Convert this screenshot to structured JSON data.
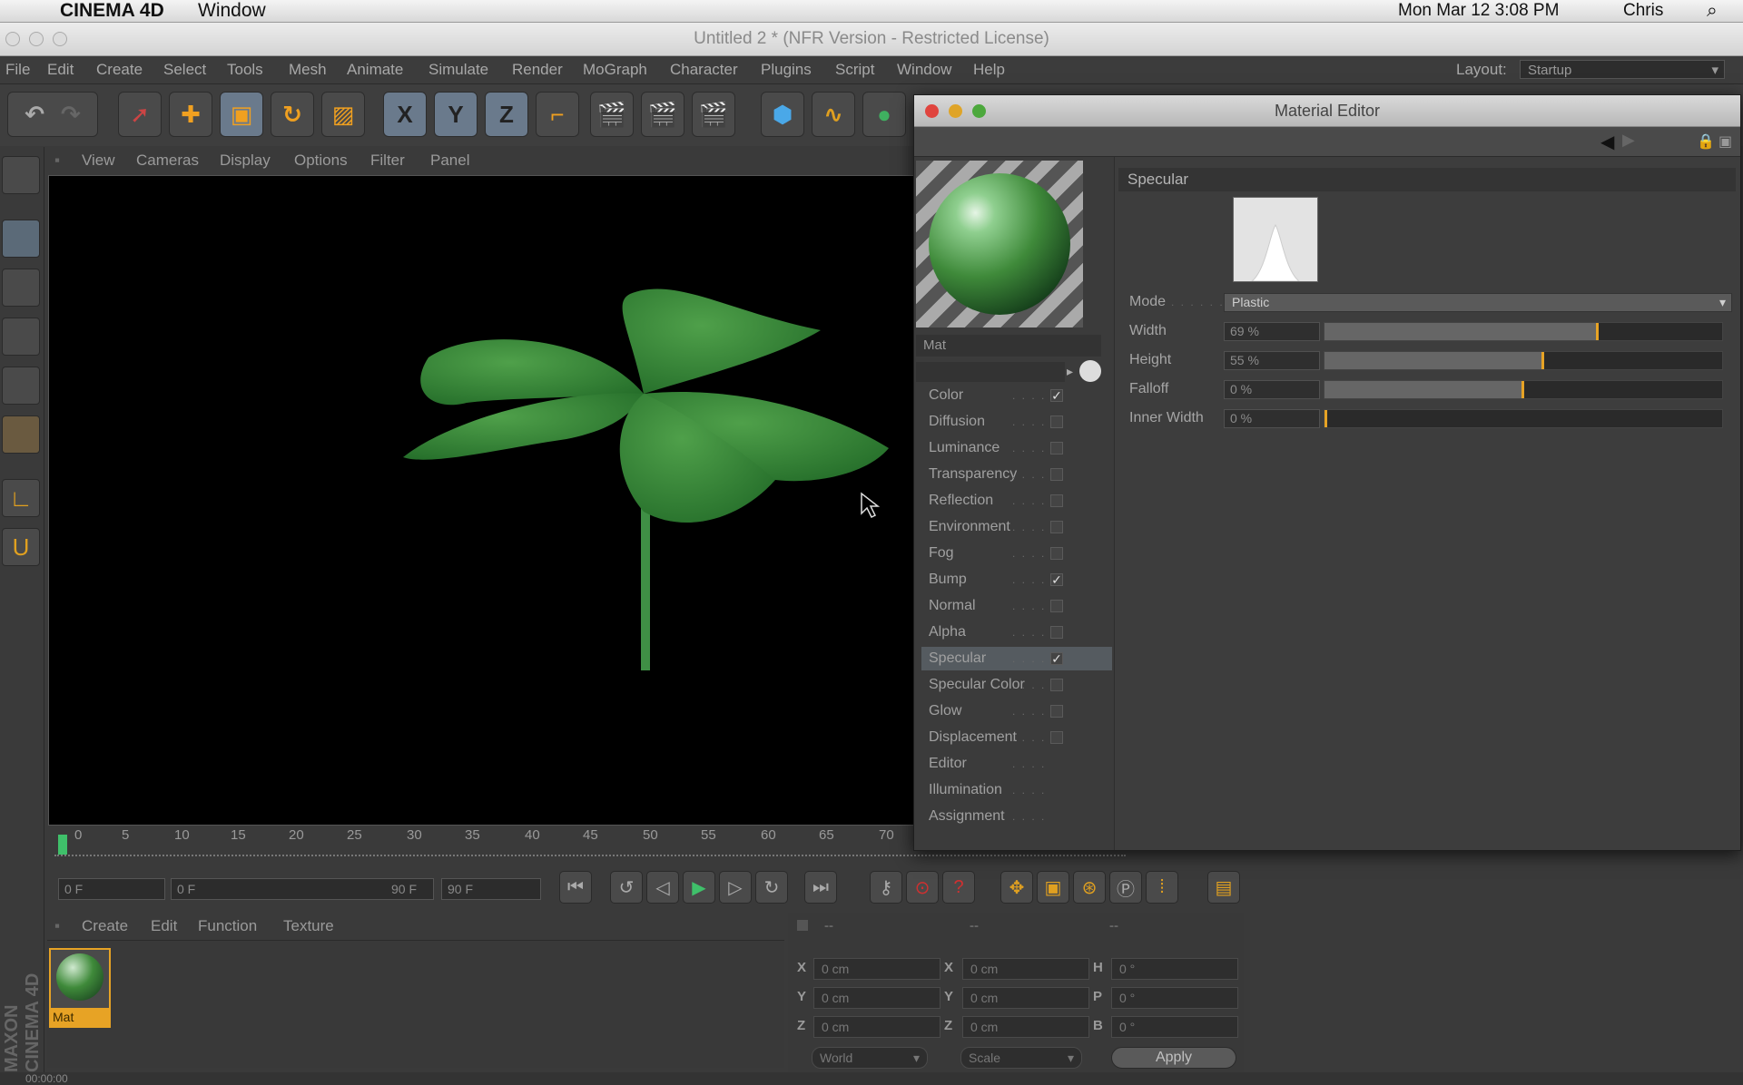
{
  "macbar": {
    "app": "CINEMA 4D",
    "menu": "Window",
    "clock": "Mon Mar 12  3:08 PM",
    "user": "Chris"
  },
  "window": {
    "title": "Untitled 2 * (NFR Version - Restricted License)"
  },
  "menubar": {
    "items": [
      "File",
      "Edit",
      "Create",
      "Select",
      "Tools",
      "Mesh",
      "Animate",
      "Simulate",
      "Render",
      "MoGraph",
      "Character",
      "Plugins",
      "Script",
      "Window",
      "Help"
    ],
    "layout_label": "Layout:",
    "layout_value": "Startup"
  },
  "toolbar": {
    "axis_x": "X",
    "axis_y": "Y",
    "axis_z": "Z"
  },
  "viewport_menu": {
    "items": [
      "View",
      "Cameras",
      "Display",
      "Options",
      "Filter",
      "Panel"
    ]
  },
  "timeline": {
    "ticks": [
      "0",
      "5",
      "10",
      "15",
      "20",
      "25",
      "30",
      "35",
      "40",
      "45",
      "50",
      "55",
      "60",
      "65",
      "70"
    ]
  },
  "transport": {
    "current": "0 F",
    "range_start": "0 F",
    "range_end": "90 F",
    "end": "90 F"
  },
  "material_manager": {
    "menu": [
      "Create",
      "Edit",
      "Function",
      "Texture"
    ],
    "material_name": "Mat",
    "brand": "MAXON CINEMA 4D"
  },
  "coordinates": {
    "header": "--",
    "pos_labels": [
      "X",
      "Y",
      "Z"
    ],
    "pos_values": [
      "0 cm",
      "0 cm",
      "0 cm"
    ],
    "size_labels": [
      "X",
      "Y",
      "Z"
    ],
    "size_values": [
      "0 cm",
      "0 cm",
      "0 cm"
    ],
    "rot_labels": [
      "H",
      "P",
      "B"
    ],
    "rot_values": [
      "0 °",
      "0 °",
      "0 °"
    ],
    "mode1": "World",
    "mode2": "Scale",
    "apply": "Apply"
  },
  "statusbar": {
    "time": "00:00:00"
  },
  "material_editor": {
    "title": "Material Editor",
    "material_name": "Mat",
    "channels": [
      {
        "label": "Color",
        "checked": true
      },
      {
        "label": "Diffusion",
        "checked": false
      },
      {
        "label": "Luminance",
        "checked": false
      },
      {
        "label": "Transparency",
        "checked": false
      },
      {
        "label": "Reflection",
        "checked": false
      },
      {
        "label": "Environment",
        "checked": false
      },
      {
        "label": "Fog",
        "checked": false
      },
      {
        "label": "Bump",
        "checked": true
      },
      {
        "label": "Normal",
        "checked": false
      },
      {
        "label": "Alpha",
        "checked": false
      },
      {
        "label": "Specular",
        "checked": true,
        "active": true
      },
      {
        "label": "Specular Color",
        "checked": false
      },
      {
        "label": "Glow",
        "checked": false
      },
      {
        "label": "Displacement",
        "checked": false
      },
      {
        "label": "Editor",
        "checked": null
      },
      {
        "label": "Illumination",
        "checked": null
      },
      {
        "label": "Assignment",
        "checked": null
      }
    ],
    "section_title": "Specular",
    "mode_label": "Mode",
    "mode_value": "Plastic",
    "params": [
      {
        "label": "Width",
        "value": "69 %",
        "level": 0.69
      },
      {
        "label": "Height",
        "value": "55 %",
        "level": 0.55
      },
      {
        "label": "Falloff",
        "value": "0 %",
        "level": 0.5
      },
      {
        "label": "Inner Width",
        "value": "0 %",
        "level": 0.0
      }
    ]
  },
  "colors": {
    "accent": "#e7a325",
    "leaf": "#3f8a3a",
    "panel": "#3b3b3b"
  }
}
